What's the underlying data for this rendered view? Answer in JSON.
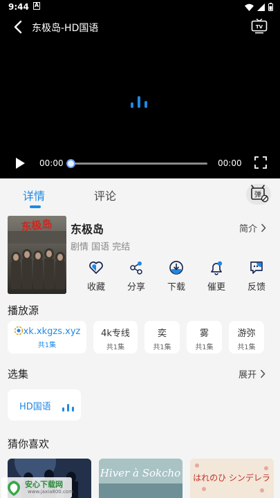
{
  "status": {
    "time": "9:44",
    "notif_letter": "A"
  },
  "player": {
    "title": "东极岛-HD国语",
    "current_time": "00:00",
    "total_time": "00:00",
    "progress": 0
  },
  "tabs": [
    {
      "label": "详情"
    },
    {
      "label": "评论"
    }
  ],
  "danmu": {
    "label": "弹"
  },
  "info": {
    "name": "东极岛",
    "meta": "剧情 国语 完结",
    "intro_label": "简介",
    "poster_title": "东极岛"
  },
  "actions": [
    {
      "label": "收藏",
      "icon": "heart-icon"
    },
    {
      "label": "分享",
      "icon": "share-icon"
    },
    {
      "label": "下载",
      "icon": "download-icon"
    },
    {
      "label": "催更",
      "icon": "bell-icon"
    },
    {
      "label": "反馈",
      "icon": "feedback-icon"
    }
  ],
  "sources": {
    "title": "播放源",
    "items": [
      {
        "name": "xk.xkgzs.xyz",
        "count": "共1集"
      },
      {
        "name": "4k专线",
        "count": "共1集"
      },
      {
        "name": "奕",
        "count": "共1集"
      },
      {
        "name": "雾",
        "count": "共1集"
      },
      {
        "name": "游弥",
        "count": "共1集"
      }
    ]
  },
  "episodes": {
    "title": "选集",
    "expand_label": "展开",
    "items": [
      {
        "label": "HD国语"
      }
    ]
  },
  "recommend": {
    "title": "猜你喜欢",
    "items": [
      {
        "poster_text": ""
      },
      {
        "poster_text": "Hiver à Sokcho"
      },
      {
        "poster_text": "はれのひ シンデレラ"
      }
    ]
  },
  "watermark": {
    "main": "安心下载网",
    "sub": "www.jaxia800.com"
  },
  "colors": {
    "accent": "#1e88e5",
    "background": "#f4f4f4",
    "player": "#000000"
  }
}
